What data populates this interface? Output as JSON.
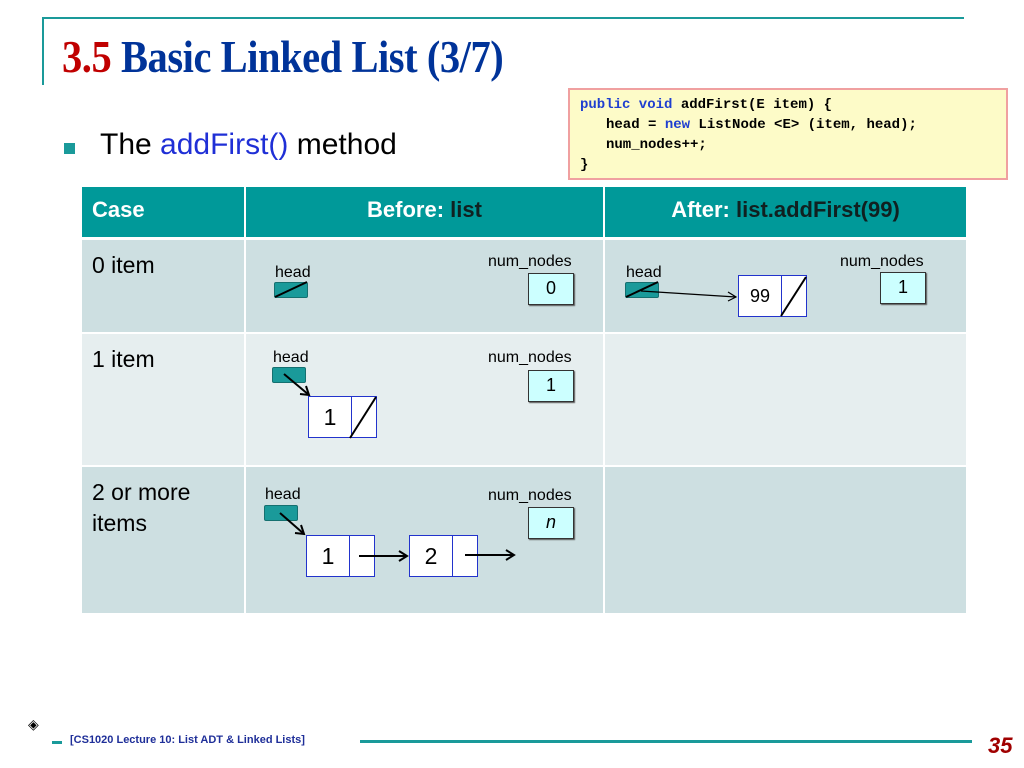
{
  "slide": {
    "title_number": "3.5",
    "title_text": "Basic Linked List (3/7)",
    "bullet": {
      "prefix": "The",
      "highlight": "addFirst()",
      "suffix": "method"
    },
    "code": {
      "line1_kw": "public void",
      "line1_rest": " addFirst(E item) {",
      "line2_pre": "head = ",
      "line2_kw": "new",
      "line2_rest": " ListNode <E> (item, head);",
      "line3": "num_nodes++;",
      "line4": "}"
    },
    "table": {
      "headers": {
        "case": "Case",
        "before_label": "Before: ",
        "before_value": "list",
        "after_label": "After: ",
        "after_value": "list.addFirst(99)"
      },
      "rows": [
        {
          "case": "0 item",
          "before": {
            "head_label": "head",
            "count_label": "num_nodes",
            "count": "0",
            "nodes": []
          },
          "after": {
            "head_label": "head",
            "count_label": "num_nodes",
            "count": "1",
            "nodes": [
              "99"
            ]
          }
        },
        {
          "case": "1 item",
          "before": {
            "head_label": "head",
            "count_label": "num_nodes",
            "count": "1",
            "nodes": [
              "1"
            ]
          },
          "after": null
        },
        {
          "case": "2 or more items",
          "case_line1": "2 or more",
          "case_line2": "items",
          "before": {
            "head_label": "head",
            "count_label": "num_nodes",
            "count": "n",
            "nodes": [
              "1",
              "2"
            ]
          },
          "after": null
        }
      ]
    },
    "footer": {
      "icon": "diamond-bullet-icon",
      "text": "[CS1020 Lecture 10: List ADT & Linked Lists]",
      "page_number": "35"
    },
    "colors": {
      "teal": "#009999",
      "title_blue": "#003399",
      "title_red": "#c00000",
      "code_bg": "#fdfbc8",
      "counter_bg": "#ccffff",
      "node_border": "#2233cc"
    }
  }
}
